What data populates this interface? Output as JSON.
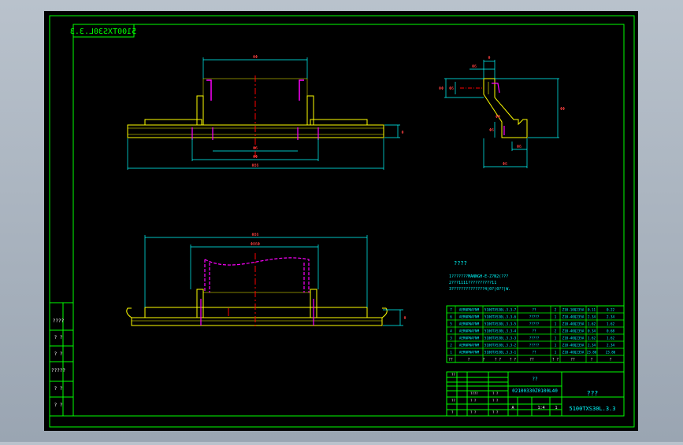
{
  "colors": {
    "background": "#000000",
    "frame": "#00ff00",
    "outline": "#ffff00",
    "dimension": "#00ffff",
    "hidden": "#ff00ff",
    "centerline": "#ff0000",
    "text": "#ffffff"
  },
  "stamp": "5100TXS30L.3.3",
  "left_panel": {
    "labels": [
      "????",
      "? ?",
      "? ?",
      "?????",
      "? ?",
      "? ?"
    ]
  },
  "dims": {
    "top_width": "ΦΦ",
    "bottom_1": "Φ6",
    "bottom_2": "ΦΦ",
    "bottom_3": "Φ86",
    "height_right": "Φ",
    "bottom_top_1": "Φ86",
    "bottom_top_2": "Φ86Φ",
    "bottom_height": "Φ"
  },
  "detail_dims": [
    "Φ",
    "Φ6",
    "ΦΦ",
    "Φ6",
    "ΦΦ",
    "Φ6",
    "Φ6",
    "Φ6",
    "ΦΦ"
  ],
  "notes": {
    "title": "????",
    "line1": "1???????MANNGH-E-Z?N2(???",
    "line2": "2???1111??????????11",
    "line3": "3??????????????4|0?|0??|W."
  },
  "parts_table": {
    "rows": [
      [
        "7",
        "AERNPNAFNM",
        "5100TXS30L.3.3-7",
        "??",
        "2",
        "Z10-10Q235A",
        "0.11",
        "0.22"
      ],
      [
        "6",
        "AERNPNAFNM",
        "5100TXS30L.3.3-6",
        "?????",
        "1",
        "Z10-40Q235A",
        "2.34",
        "2.34"
      ],
      [
        "5",
        "AERNPNAFNM",
        "5100TXS30L.3.3-5",
        "?????",
        "1",
        "Z10-40Q235A",
        "1.62",
        "1.62"
      ],
      [
        "4",
        "AERNPNAFNM",
        "5100TXS30L.3.3-4",
        "??",
        "2",
        "Z10-40Q235A",
        "0.34",
        "0.68"
      ],
      [
        "3",
        "AERNPNAFNM",
        "5100TXS30L.3.3-3",
        "?????",
        "1",
        "Z10-40Q235A",
        "1.62",
        "1.62"
      ],
      [
        "2",
        "AERNPNAFNM",
        "5100TXS30L.3.3-2",
        "?????",
        "1",
        "Z10-40Q235A",
        "2.34",
        "2.34"
      ],
      [
        "1",
        "AERNPNAFNM",
        "5100TXS30L.3.3-1",
        "??",
        "1",
        "Z10-40Q235A",
        "23.86",
        "23.86"
      ]
    ],
    "header": [
      "??",
      "?",
      "?",
      "? ?",
      "? ?",
      "??",
      "? ?",
      "??",
      "?",
      "?"
    ]
  },
  "title_block": {
    "code": "02100330Z0100L40",
    "company": "??",
    "title": "???",
    "drawing_no": "5100TXS30L.3.3",
    "scale": "1:4",
    "sheet": "1",
    "mark": "A",
    "small_labels": [
      "??",
      "????",
      "? ?",
      "??",
      "? ?",
      "? ?",
      "?",
      "? ?",
      "? ?"
    ]
  }
}
